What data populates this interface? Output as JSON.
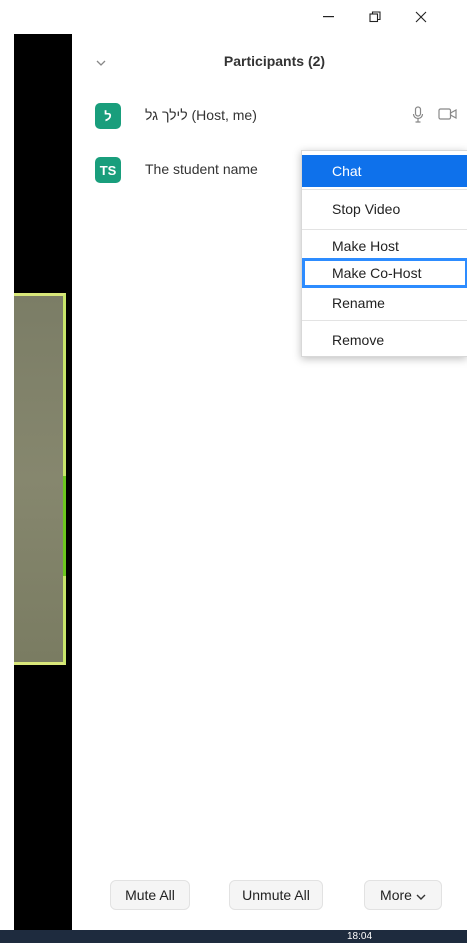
{
  "window": {
    "minimize_label": "Minimize",
    "restore_label": "Restore",
    "close_label": "Close"
  },
  "panel": {
    "title": "Participants (2)"
  },
  "participants": [
    {
      "initials": "ל",
      "name": "לילך גל (Host, me)",
      "mic": "microphone-icon",
      "video": "video-camera-icon"
    },
    {
      "initials": "TS",
      "name": "The student name"
    }
  ],
  "context_menu": {
    "items": [
      {
        "label": "Chat",
        "state": "highlighted"
      },
      {
        "label": "Stop Video"
      },
      {
        "label": "Make Host"
      },
      {
        "label": "Make Co-Host",
        "state": "focused"
      },
      {
        "label": "Rename"
      },
      {
        "label": "Remove"
      }
    ]
  },
  "footer": {
    "mute_all": "Mute All",
    "unmute_all": "Unmute All",
    "more": "More"
  },
  "taskbar": {
    "clock": "18:04"
  },
  "colors": {
    "avatar": "#199e7c",
    "menu_highlight": "#0e71eb",
    "focus_outline": "#2d8cff",
    "taskbar": "#1e2b3e"
  }
}
